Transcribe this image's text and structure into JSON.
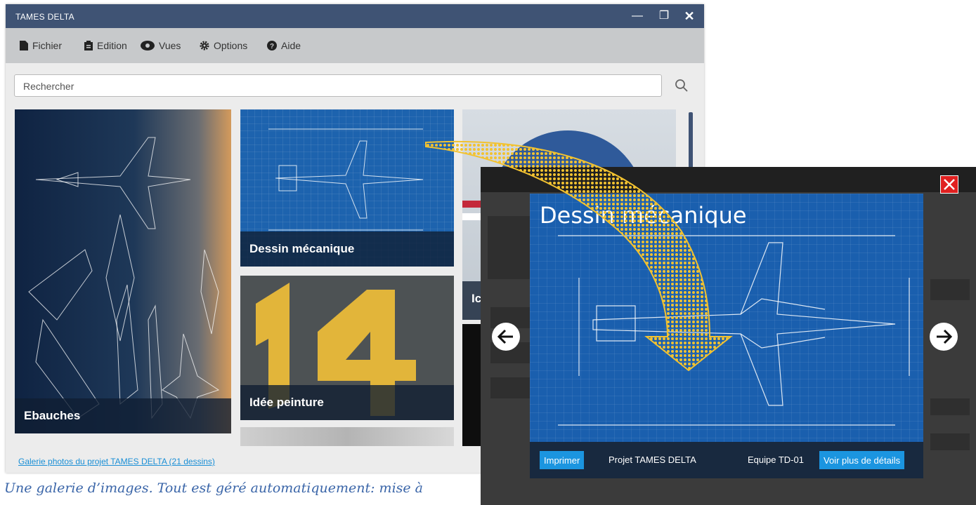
{
  "window": {
    "title": "TAMES DELTA",
    "minimize": "—",
    "maximize": "❐",
    "close": "✕"
  },
  "menu": [
    {
      "label": "Fichier",
      "icon": "file-icon"
    },
    {
      "label": "Edition",
      "icon": "clipboard-icon"
    },
    {
      "label": "Vues",
      "icon": "eye-icon"
    },
    {
      "label": "Options",
      "icon": "gear-icon"
    },
    {
      "label": "Aide",
      "icon": "help-icon"
    }
  ],
  "search": {
    "placeholder": "Rechercher"
  },
  "tiles": [
    {
      "label": "Ebauches"
    },
    {
      "label": "Dessin mécanique"
    },
    {
      "label": "Idée peinture"
    },
    {
      "label": "Ic"
    }
  ],
  "gallery_link": "Galerie photos du projet TAMES DELTA (21 dessins)",
  "caption": "Une galerie d’images. Tout est géré automatiquement: mise à",
  "modal": {
    "title": "Dessin mécanique",
    "print_button": "Imprimer",
    "project": "Projet TAMES DELTA",
    "team": "Equipe TD-01",
    "details_button": "Voir plus de détails"
  },
  "colors": {
    "titlebar": "#3f5374",
    "accent": "#1b95e0",
    "close_red": "#e02020",
    "arrow_yellow": "#f2c230"
  }
}
